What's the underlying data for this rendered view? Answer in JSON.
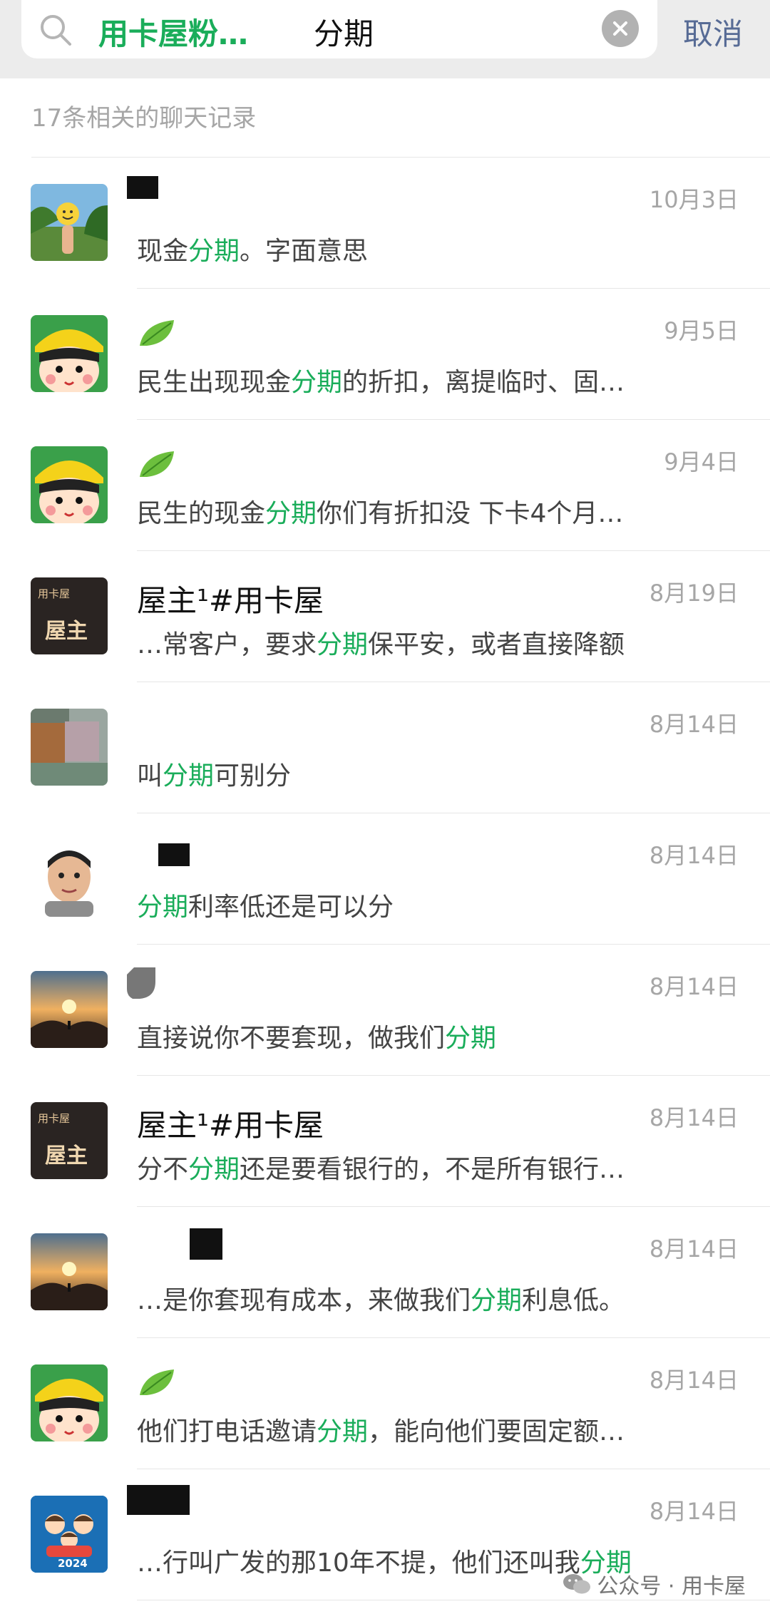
{
  "search": {
    "tag": "用卡屋粉…",
    "query": "分期",
    "cancel_label": "取消"
  },
  "result_count": "17条相关的聊天记录",
  "results": [
    {
      "name": "",
      "date": "10月3日",
      "msg_before": "现金",
      "msg_hl": "分期",
      "msg_after": "。字面意思"
    },
    {
      "name": "",
      "date": "9月5日",
      "msg_before": "民生出现现金",
      "msg_hl": "分期",
      "msg_after": "的折扣，离提临时、固…"
    },
    {
      "name": "",
      "date": "9月4日",
      "msg_before": "民生的现金",
      "msg_hl": "分期",
      "msg_after": "你们有折扣没 下卡4个月…"
    },
    {
      "name": "屋主¹#用卡屋",
      "date": "8月19日",
      "msg_before": "…常客户，要求",
      "msg_hl": "分期",
      "msg_after": "保平安，或者直接降额"
    },
    {
      "name": "",
      "date": "8月14日",
      "msg_before": "叫",
      "msg_hl": "分期",
      "msg_after": "可别分"
    },
    {
      "name": "",
      "date": "8月14日",
      "msg_before": "",
      "msg_hl": "分期",
      "msg_after": "利率低还是可以分"
    },
    {
      "name": "",
      "date": "8月14日",
      "msg_before": "直接说你不要套现，做我们",
      "msg_hl": "分期",
      "msg_after": ""
    },
    {
      "name": "屋主¹#用卡屋",
      "date": "8月14日",
      "msg_before": "分不",
      "msg_hl": "分期",
      "msg_after": "还是要看银行的，不是所有银行…"
    },
    {
      "name": "",
      "date": "8月14日",
      "msg_before": "…是你套现有成本，来做我们",
      "msg_hl": "分期",
      "msg_after": "利息低。"
    },
    {
      "name": "",
      "date": "8月14日",
      "msg_before": "他们打电话邀请",
      "msg_hl": "分期",
      "msg_after": "，能向他们要固定额…"
    },
    {
      "name": "",
      "date": "8月14日",
      "msg_before": "…行叫广发的那10年不提，他们还叫我",
      "msg_hl": "分期",
      "msg_after": ""
    }
  ],
  "avatar_badges": {
    "brand_small": "用卡屋",
    "brand_big": "屋主",
    "year": "2024"
  },
  "watermark": "公众号 · 用卡屋",
  "colors": {
    "highlight": "#1aad5a",
    "cancel": "#576b95",
    "muted": "#a6a6a6"
  }
}
